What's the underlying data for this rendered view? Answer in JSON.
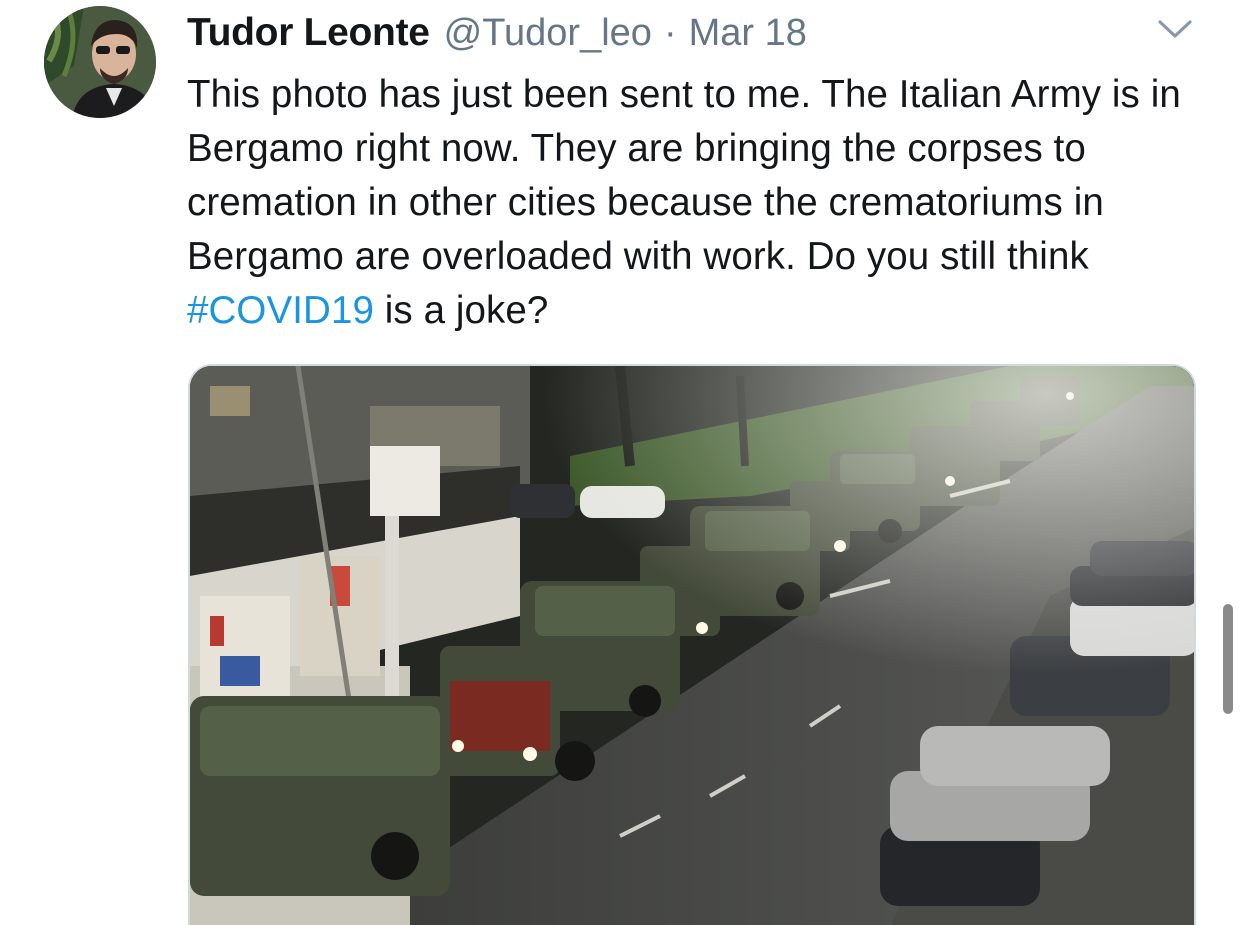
{
  "tweet": {
    "author": {
      "display_name": "Tudor Leonte",
      "handle": "@Tudor_leo"
    },
    "separator": "·",
    "date": "Mar 18",
    "text": {
      "before_hashtag": "This photo has just been sent to me. The Italian Army is in Bergamo right now. They are bringing the corpses to cremation in other cities because the crematoriums in Bergamo are overloaded with work. Do you still think ",
      "hashtag": "#COVID19",
      "after_hashtag": " is a joke?"
    },
    "media_image": "night-street-military-truck-convoy-photo",
    "menu_icon": "chevron-down-icon",
    "colors": {
      "hashtag": "#1b95e0",
      "secondary_text": "#657786",
      "primary_text": "#14171a"
    }
  }
}
